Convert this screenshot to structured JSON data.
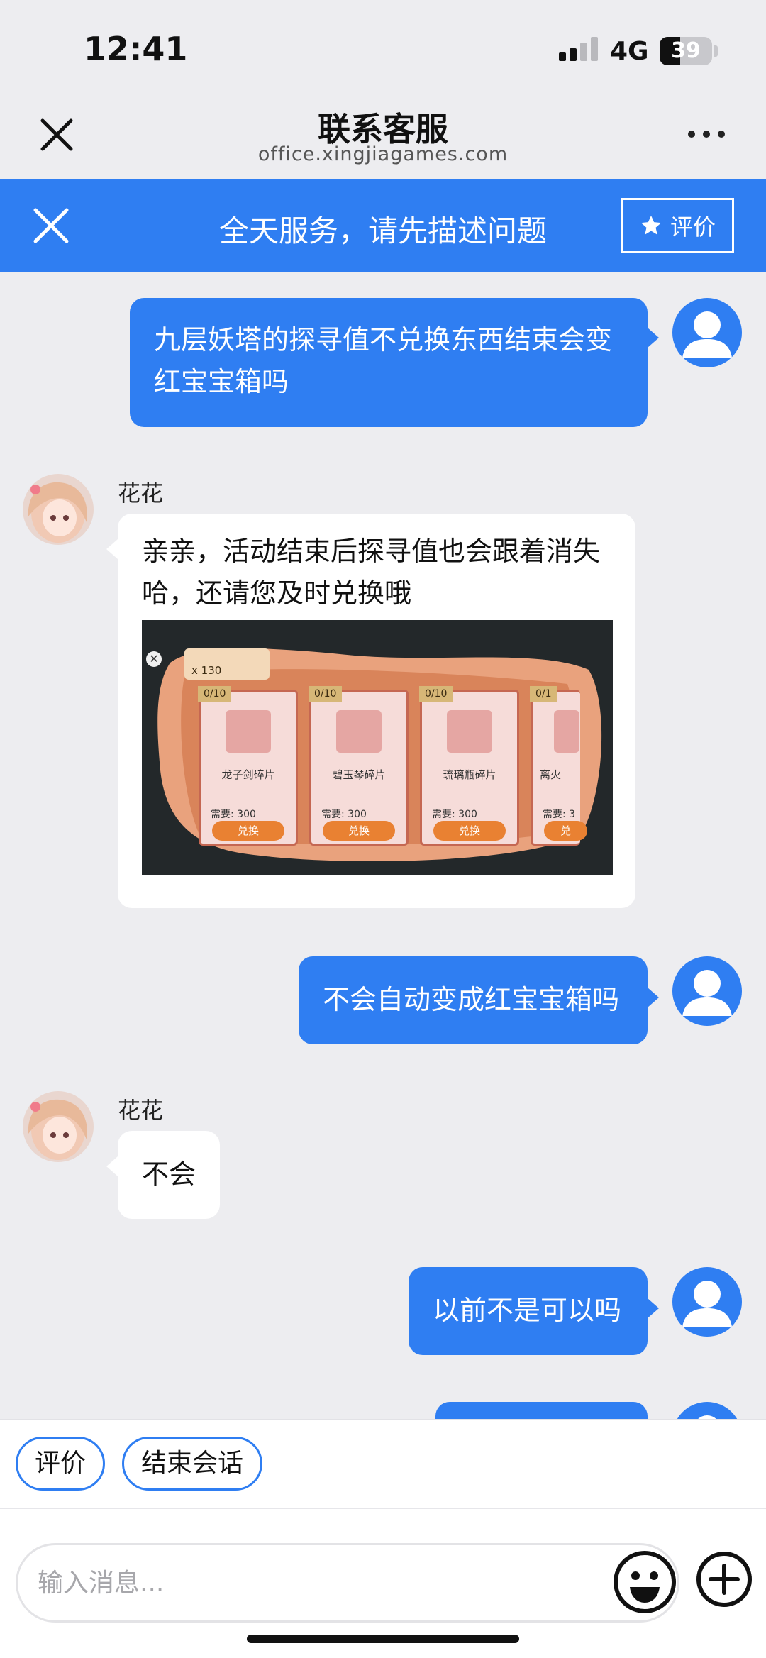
{
  "status_bar": {
    "time": "12:41",
    "network": "4G",
    "battery": "39",
    "battery_level": 0.39
  },
  "nav": {
    "title": "联系客服",
    "url": "office.xingjiagames.com",
    "close_icon": "close-icon",
    "more_icon": "more-icon"
  },
  "service_bar": {
    "text": "全天服务，请先描述问题",
    "rate_label": "评价",
    "star_icon": "star-icon"
  },
  "colors": {
    "accent": "#2f7ef2",
    "background": "#ededf0",
    "bubble_in": "#ffffff"
  },
  "chat": {
    "agent_name": "花花",
    "messages": [
      {
        "from": "user",
        "lines": [
          "九层妖塔的探寻值不兑换东西结束会变",
          "红宝宝箱吗"
        ]
      },
      {
        "from": "agent",
        "name": "花花",
        "lines": [
          "亲亲，活动结束后探寻值也会跟着消失",
          "哈，还请您及时兑换哦"
        ]
      },
      {
        "from": "user",
        "lines": [
          "不会自动变成红宝宝箱吗"
        ]
      },
      {
        "from": "agent",
        "name": "花花",
        "lines": [
          "不会"
        ]
      },
      {
        "from": "user",
        "lines": [
          "以前不是可以吗"
        ]
      }
    ],
    "game_image": {
      "currency_count": "x 130",
      "cards": [
        {
          "name": "龙子剑碎片",
          "cost": "需要:",
          "cost_value": "300",
          "button": "兑换"
        },
        {
          "name": "碧玉琴碎片",
          "cost": "需要:",
          "cost_value": "300",
          "button": "兑换"
        },
        {
          "name": "琉璃瓶碎片",
          "cost": "需要:",
          "cost_value": "300",
          "button": "兑换"
        },
        {
          "name": "离火",
          "cost": "需要:",
          "cost_value": "3",
          "button": "兑"
        }
      ]
    }
  },
  "quick_actions": {
    "rate": "评价",
    "end_session": "结束会话"
  },
  "input": {
    "placeholder": "输入消息...",
    "value": "",
    "emoji_icon": "emoji-icon",
    "plus_icon": "plus-icon"
  }
}
